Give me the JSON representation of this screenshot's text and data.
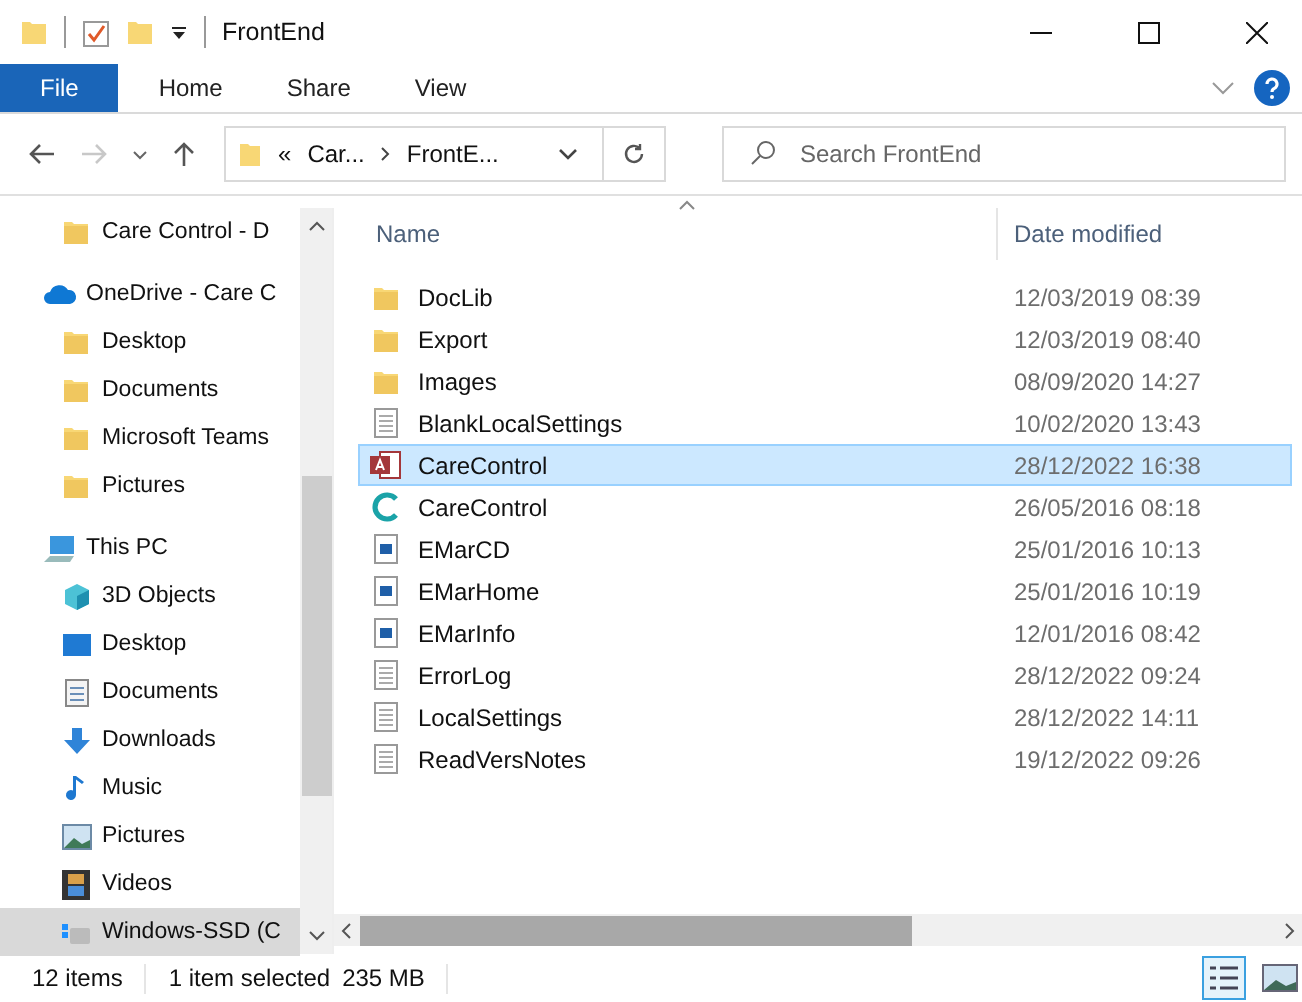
{
  "window": {
    "title": "FrontEnd"
  },
  "ribbon_tabs": [
    {
      "label": "File",
      "selected": true
    },
    {
      "label": "Home",
      "selected": false
    },
    {
      "label": "Share",
      "selected": false
    },
    {
      "label": "View",
      "selected": false
    }
  ],
  "address": {
    "overflow": "«",
    "crumbs": [
      "Car...",
      "FrontE..."
    ]
  },
  "search": {
    "placeholder": "Search FrontEnd"
  },
  "sidebar": {
    "items": [
      {
        "label": "Care Control - D",
        "kind": "folder",
        "indent": true,
        "selected": false
      },
      {
        "label": "OneDrive - Care C",
        "kind": "cloud",
        "indent": false,
        "selected": false
      },
      {
        "label": "Desktop",
        "kind": "folder",
        "indent": true,
        "selected": false
      },
      {
        "label": "Documents",
        "kind": "folder",
        "indent": true,
        "selected": false
      },
      {
        "label": "Microsoft Teams",
        "kind": "folder",
        "indent": true,
        "selected": false
      },
      {
        "label": "Pictures",
        "kind": "folder",
        "indent": true,
        "selected": false
      },
      {
        "label": "This PC",
        "kind": "pc",
        "indent": false,
        "selected": false
      },
      {
        "label": "3D Objects",
        "kind": "cube",
        "indent": true,
        "selected": false
      },
      {
        "label": "Desktop",
        "kind": "desktop",
        "indent": true,
        "selected": false
      },
      {
        "label": "Documents",
        "kind": "docs",
        "indent": true,
        "selected": false
      },
      {
        "label": "Downloads",
        "kind": "download",
        "indent": true,
        "selected": false
      },
      {
        "label": "Music",
        "kind": "music",
        "indent": true,
        "selected": false
      },
      {
        "label": "Pictures",
        "kind": "pictures",
        "indent": true,
        "selected": false
      },
      {
        "label": "Videos",
        "kind": "videos",
        "indent": true,
        "selected": false
      },
      {
        "label": "Windows-SSD (C",
        "kind": "drive",
        "indent": true,
        "selected": true
      }
    ]
  },
  "table": {
    "columns": [
      "Name",
      "Date modified"
    ],
    "rows": [
      {
        "name": "DocLib",
        "date": "12/03/2019 08:39",
        "kind": "folder",
        "selected": false
      },
      {
        "name": "Export",
        "date": "12/03/2019 08:40",
        "kind": "folder",
        "selected": false
      },
      {
        "name": "Images",
        "date": "08/09/2020 14:27",
        "kind": "folder",
        "selected": false
      },
      {
        "name": "BlankLocalSettings",
        "date": "10/02/2020 13:43",
        "kind": "text",
        "selected": false
      },
      {
        "name": "CareControl",
        "date": "28/12/2022 16:38",
        "kind": "access",
        "selected": true
      },
      {
        "name": "CareControl",
        "date": "26/05/2016 08:18",
        "kind": "app",
        "selected": false
      },
      {
        "name": "EMarCD",
        "date": "25/01/2016 10:13",
        "kind": "image",
        "selected": false
      },
      {
        "name": "EMarHome",
        "date": "25/01/2016 10:19",
        "kind": "image",
        "selected": false
      },
      {
        "name": "EMarInfo",
        "date": "12/01/2016 08:42",
        "kind": "image",
        "selected": false
      },
      {
        "name": "ErrorLog",
        "date": "28/12/2022 09:24",
        "kind": "text",
        "selected": false
      },
      {
        "name": "LocalSettings",
        "date": "28/12/2022 14:11",
        "kind": "text",
        "selected": false
      },
      {
        "name": "ReadVersNotes",
        "date": "19/12/2022 09:26",
        "kind": "text",
        "selected": false
      }
    ]
  },
  "status_bar": {
    "count": "12 items",
    "selection": "1 item selected",
    "size": "235 MB"
  },
  "view_buttons": [
    {
      "kind": "details",
      "selected": true
    },
    {
      "kind": "thumbnails",
      "selected": false
    }
  ]
}
